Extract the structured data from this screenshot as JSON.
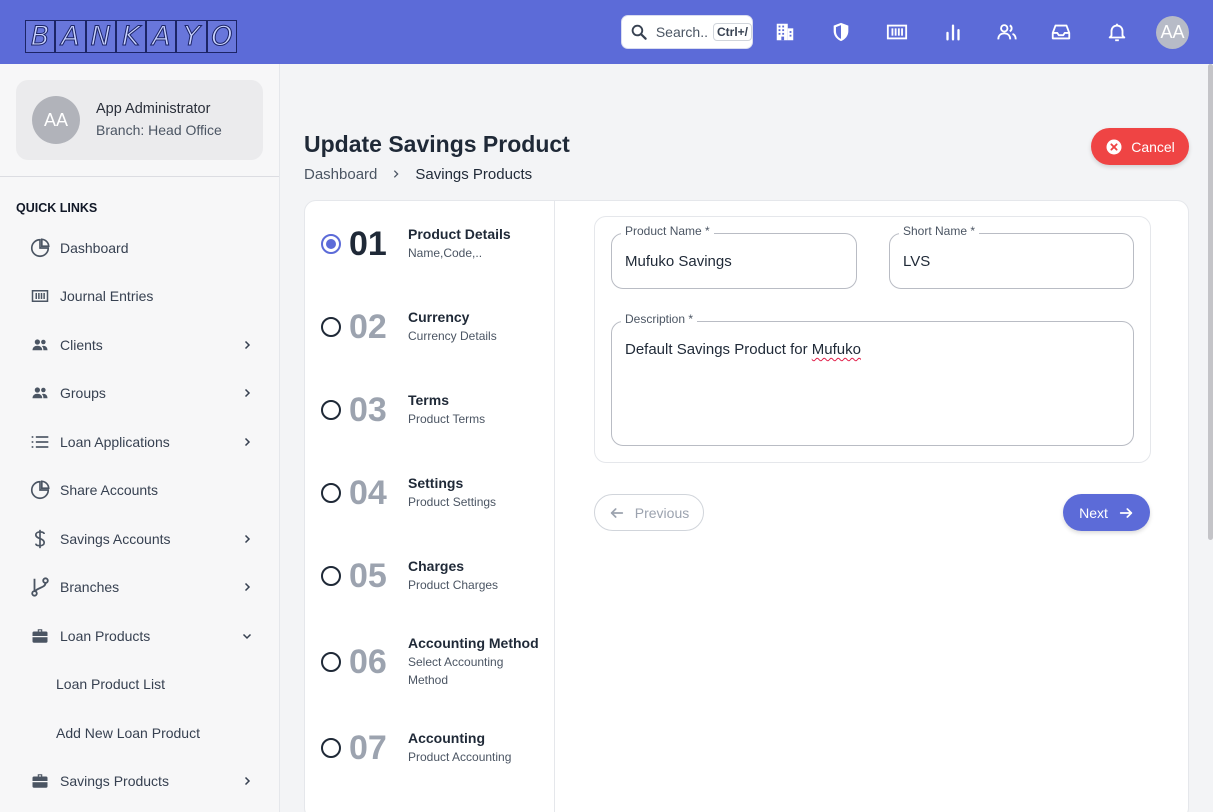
{
  "app": {
    "logo_letters": [
      "B",
      "A",
      "N",
      "K",
      "A",
      "Y",
      "O"
    ]
  },
  "topbar": {
    "search_placeholder": "Search..",
    "search_shortcut": "Ctrl+/",
    "icons": [
      "building-icon",
      "shield-icon",
      "tally-icon",
      "bar-chart-icon",
      "users-icon",
      "inbox-icon",
      "bell-icon"
    ],
    "avatar_initials": "AA",
    "bg_color": "#5c6bd8"
  },
  "user": {
    "initials": "AA",
    "name": "App Administrator",
    "branch": "Branch: Head Office"
  },
  "sidebar": {
    "quick_links_title": "QUICK LINKS",
    "items": [
      {
        "label": "Dashboard",
        "icon": "pie-chart-icon",
        "has_chevron": false
      },
      {
        "label": "Journal Entries",
        "icon": "ledger-icon",
        "has_chevron": false
      },
      {
        "label": "Clients",
        "icon": "users-icon",
        "has_chevron": true
      },
      {
        "label": "Groups",
        "icon": "users-icon",
        "has_chevron": true
      },
      {
        "label": "Loan Applications",
        "icon": "list-icon",
        "has_chevron": true
      },
      {
        "label": "Share Accounts",
        "icon": "pie-chart-icon",
        "has_chevron": false
      },
      {
        "label": "Savings Accounts",
        "icon": "dollar-icon",
        "has_chevron": true
      },
      {
        "label": "Branches",
        "icon": "branch-icon",
        "has_chevron": true
      },
      {
        "label": "Loan Products",
        "icon": "briefcase-icon",
        "has_chevron": true,
        "expanded": true
      },
      {
        "label": "Savings Products",
        "icon": "briefcase-icon",
        "has_chevron": true
      }
    ],
    "sub_items": [
      "Loan Product List",
      "Add New Loan Product"
    ]
  },
  "page": {
    "title": "Update Savings Product",
    "breadcrumb": [
      "Dashboard",
      "Savings Products"
    ],
    "cancel_label": "Cancel"
  },
  "steps": [
    {
      "number": "01",
      "title": "Product Details",
      "subtitle": "Name,Code,..",
      "active": true
    },
    {
      "number": "02",
      "title": "Currency",
      "subtitle": "Currency Details",
      "active": false
    },
    {
      "number": "03",
      "title": "Terms",
      "subtitle": "Product Terms",
      "active": false
    },
    {
      "number": "04",
      "title": "Settings",
      "subtitle": "Product Settings",
      "active": false
    },
    {
      "number": "05",
      "title": "Charges",
      "subtitle": "Product Charges",
      "active": false
    },
    {
      "number": "06",
      "title": "Accounting Method",
      "subtitle": "Select Accounting Method",
      "active": false
    },
    {
      "number": "07",
      "title": "Accounting",
      "subtitle": "Product Accounting",
      "active": false
    }
  ],
  "form": {
    "product_name_label": "Product Name *",
    "product_name_value": "Mufuko Savings",
    "short_name_label": "Short Name *",
    "short_name_value": "LVS",
    "description_label": "Description *",
    "description_prefix": "Default Savings Product for ",
    "description_misspelled": "Mufuko",
    "previous_label": "Previous",
    "next_label": "Next"
  }
}
